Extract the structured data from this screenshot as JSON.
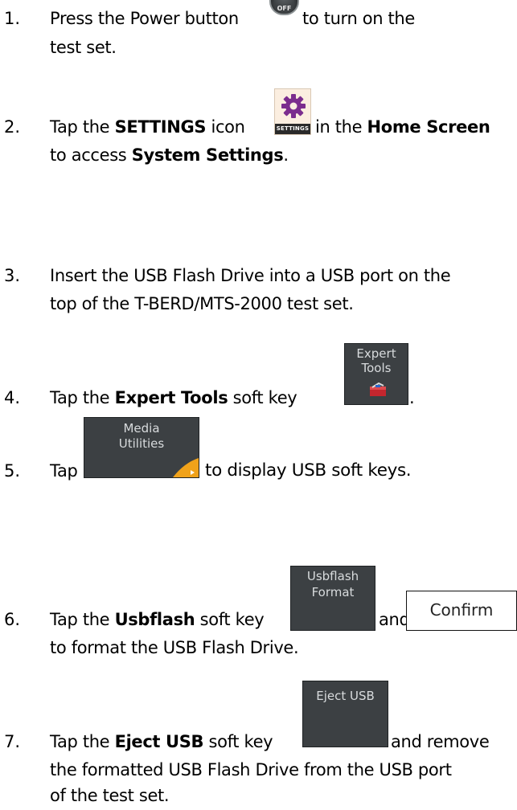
{
  "steps": [
    {
      "num": "1.",
      "line1_a": "Press the Power button",
      "line1_b": "to turn on the",
      "line2": "test set."
    },
    {
      "num": "2.",
      "a": "Tap the ",
      "b": "SETTINGS",
      "c": " icon",
      "d": "in the ",
      "e": "Home Screen",
      "line2_a": "to access ",
      "line2_b": "System Settings",
      "line2_c": "."
    },
    {
      "num": "3.",
      "line1": "Insert the USB Flash Drive into a USB port on the",
      "line2": "top of the T-BERD/MTS-2000 test set."
    },
    {
      "num": "4.",
      "a": "Tap the ",
      "b": "Expert Tools",
      "c": " soft key",
      "d": "."
    },
    {
      "num": "5.",
      "a": "Tap",
      "b": "to display USB soft keys."
    },
    {
      "num": "6.",
      "a": "Tap the ",
      "b": "Usbflash",
      "c": " soft key",
      "d": "and",
      "line2": "to format the USB Flash Drive."
    },
    {
      "num": "7.",
      "a": "Tap the ",
      "b": "Eject USB",
      "c": " soft key",
      "d": "and remove",
      "line2": "the formatted USB Flash Drive from the USB port",
      "line3": "of the test set."
    }
  ],
  "icons": {
    "power_text": "OFF",
    "settings_caption": "SETTINGS",
    "expert_tools": [
      "Expert",
      "Tools"
    ],
    "media_utilities": [
      "Media",
      "Utilities"
    ],
    "usbflash_format": [
      "Usbflash",
      "Format"
    ],
    "confirm": "Confirm",
    "eject_usb": "Eject USB"
  },
  "colors": {
    "settings_gear": "#7b2d8e",
    "softkey_bg": "#3c4043"
  }
}
